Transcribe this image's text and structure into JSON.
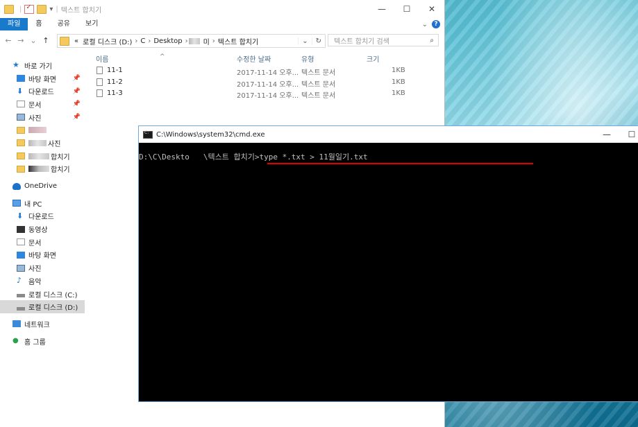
{
  "explorer": {
    "title": "텍스트 합치기",
    "ribbon_tabs": [
      "파일",
      "홈",
      "공유",
      "보기"
    ],
    "breadcrumb": [
      "«",
      "로컬 디스크 (D:)",
      "C",
      "Desktop",
      "미",
      "텍스트 합치기"
    ],
    "search_placeholder": "텍스트 합치기 검색",
    "columns": {
      "name": "이름",
      "date": "수정한 날짜",
      "type": "유형",
      "size": "크기"
    },
    "files": [
      {
        "name": "11-1",
        "date": "2017-11-14 오후...",
        "type": "텍스트 문서",
        "size": "1KB"
      },
      {
        "name": "11-2",
        "date": "2017-11-14 오후...",
        "type": "텍스트 문서",
        "size": "1KB"
      },
      {
        "name": "11-3",
        "date": "2017-11-14 오후...",
        "type": "텍스트 문서",
        "size": "1KB"
      }
    ],
    "nav": {
      "quick_access": "바로 가기",
      "qa_desktop": "바탕 화면",
      "qa_downloads": "다운로드",
      "qa_documents": "문서",
      "qa_pictures": "사진",
      "folder_photos": "사진",
      "folder_merge1": "합치기",
      "folder_merge2": "합치기",
      "onedrive": "OneDrive",
      "mypc": "내 PC",
      "pc_downloads": "다운로드",
      "pc_videos": "동영상",
      "pc_documents": "문서",
      "pc_desktop": "바탕 화면",
      "pc_pictures": "사진",
      "pc_music": "음악",
      "drive_c": "로컬 디스크 (C:)",
      "drive_d": "로컬 디스크 (D:)",
      "network": "네트워크",
      "homegroup": "홈 그룹"
    }
  },
  "cmd": {
    "title": "C:\\Windows\\system32\\cmd.exe",
    "line_prefix": "D:\\C\\Deskto",
    "line_mid": "\\텍스트 합치기>",
    "command": "type *.txt > 11월일기.txt"
  },
  "icons": [
    "folder-icon",
    "checkbox-icon",
    "search-icon",
    "help-icon",
    "star-icon",
    "download-icon",
    "cloud-icon",
    "pc-icon",
    "music-icon",
    "network-icon",
    "homegroup-icon",
    "cmd-icon"
  ],
  "colors": {
    "accent": "#1979ca",
    "underline": "#e00000",
    "cmd_bg": "#000000",
    "cmd_text": "#c0c0c0"
  }
}
